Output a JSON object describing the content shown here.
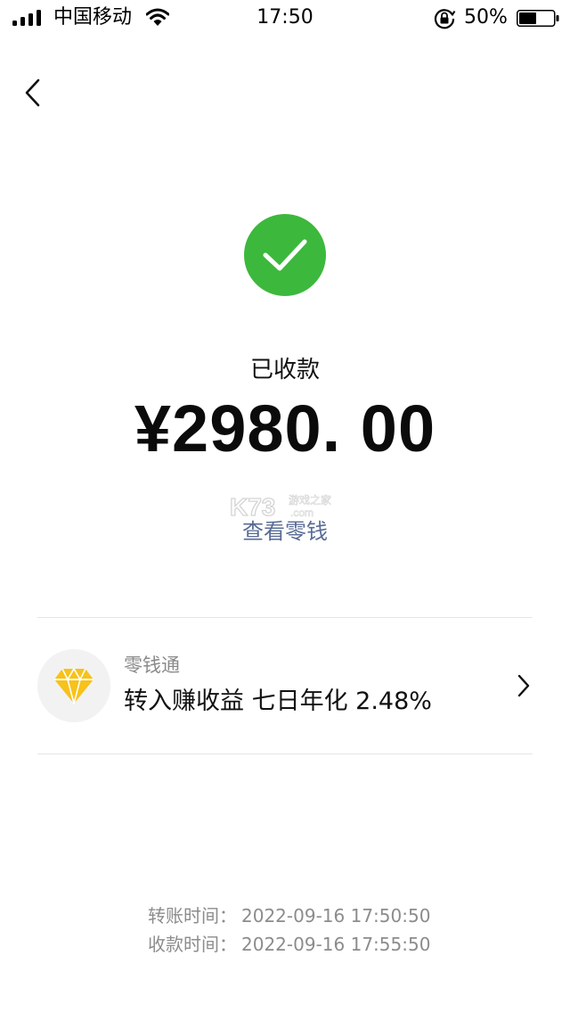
{
  "status_bar": {
    "carrier": "中国移动",
    "time": "17:50",
    "battery_percent": "50%",
    "battery_level": 0.5
  },
  "header": {
    "back_icon": "chevron-left-icon"
  },
  "receipt": {
    "status_icon": "check-circle-icon",
    "status_label": "已收款",
    "amount": "¥2980. 00",
    "view_change_link": "查看零钱",
    "accent_color": "#3cb83c",
    "link_color": "#576b95"
  },
  "watermark": {
    "logo": "K73",
    "tagline": "游戏之家",
    "domain": ".com"
  },
  "promo": {
    "icon": "diamond-icon",
    "title": "零钱通",
    "description": "转入赚收益 七日年化 2.48%"
  },
  "times": {
    "transfer_label": "转账时间：",
    "transfer_value": "2022-09-16 17:50:50",
    "receive_label": "收款时间：",
    "receive_value": "2022-09-16 17:55:50"
  }
}
